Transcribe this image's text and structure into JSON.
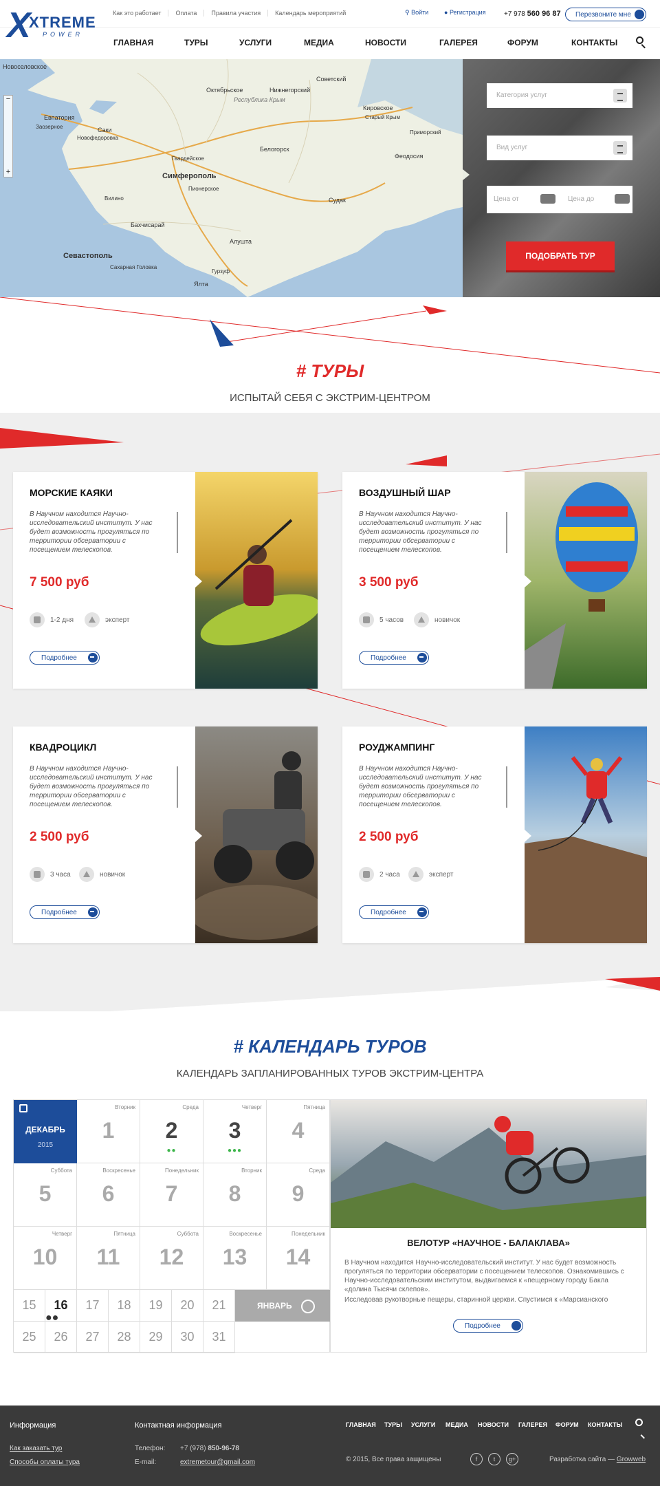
{
  "header": {
    "logo_big": "XTREME",
    "logo_small": "POWER",
    "top_links": [
      "Как это работает",
      "Оплата",
      "Правила участия",
      "Календарь мероприятий"
    ],
    "login": "Войти",
    "register": "Регистрация",
    "phone_prefix": "+7 978",
    "phone_number": "560 96 87",
    "call_button": "Перезвоните мне",
    "nav": [
      "ГЛАВНАЯ",
      "ТУРЫ",
      "УСЛУГИ",
      "МЕДИА",
      "НОВОСТИ",
      "ГАЛЕРЕЯ",
      "ФОРУМ",
      "КОНТАКТЫ"
    ]
  },
  "map": {
    "labels": {
      "novoselovskoe": "Новоселовское",
      "sovetskiy": "Советский",
      "oktyabrskoe": "Октябрьское",
      "nizhnegorskiy": "Нижнегорский",
      "respublika_krym": "Республика Крым",
      "kirovskoe": "Кировское",
      "evpatoriya": "Евпатория",
      "saki": "Саки",
      "zaozernoe": "Заозерное",
      "novofedorovka": "Новофедоровка",
      "staryy_krym": "Старый Крым",
      "primorskiy": "Приморский",
      "belogorsk": "Белогорск",
      "feodosiya": "Феодосия",
      "gvardeyskoe": "Гвардейское",
      "simferopol": "Симферополь",
      "pionerskoe": "Пионерское",
      "vilino": "Вилино",
      "bakhchisaray": "Бахчисарай",
      "sudak": "Судак",
      "sevastopol": "Севастополь",
      "alushta": "Алушта",
      "sakhar_golovka": "Сахарная Головка",
      "gurzuf": "Гурзуф",
      "yalta": "Ялта"
    }
  },
  "filter": {
    "category_placeholder": "Категория услуг",
    "type_placeholder": "Вид услуг",
    "price_from": "Цена от",
    "price_to": "Цена до",
    "submit": "ПОДОБРАТЬ ТУР"
  },
  "tours_section": {
    "title": "# ТУРЫ",
    "subtitle": "ИСПЫТАЙ СЕБЯ С ЭКСТРИМ-ЦЕНТРОМ"
  },
  "tours": [
    {
      "title": "МОРСКИЕ КАЯКИ",
      "desc": "В Научном находится Научно-исследовательский институт. У нас будет возможность прогуляться по территории обсерватории с посещением телескопов.",
      "price": "7 500 руб",
      "duration": "1-2 дня",
      "level": "эксперт",
      "more": "Подробнее"
    },
    {
      "title": "ВОЗДУШНЫЙ ШАР",
      "desc": "В Научном находится Научно-исследовательский институт. У нас будет возможность прогуляться по территории обсерватории с посещением телескопов.",
      "price": "3 500 руб",
      "duration": "5 часов",
      "level": "новичок",
      "more": "Подробнее"
    },
    {
      "title": "КВАДРОЦИКЛ",
      "desc": "В Научном находится Научно-исследовательский институт. У нас будет возможность прогуляться по территории обсерватории с посещением телескопов.",
      "price": "2 500 руб",
      "duration": "3 часа",
      "level": "новичок",
      "more": "Подробнее"
    },
    {
      "title": "РОУДЖАМПИНГ",
      "desc": "В Научном находится Научно-исследовательский институт. У нас будет возможность прогуляться по территории обсерватории с посещением телескопов.",
      "price": "2 500 руб",
      "duration": "2 часа",
      "level": "эксперт",
      "more": "Подробнее"
    }
  ],
  "calendar_section": {
    "title": "# КАЛЕНДАРЬ ТУРОВ",
    "subtitle": "КАЛЕНДАРЬ ЗАПЛАНИРОВАННЫХ ТУРОВ ЭКСТРИМ-ЦЕНТРА"
  },
  "calendar": {
    "month": "ДЕКАБРЬ",
    "year": "2015",
    "big_days": [
      {
        "day": "1",
        "dow": "Вторник",
        "dots": ""
      },
      {
        "day": "2",
        "dow": "Среда",
        "dots": "●●"
      },
      {
        "day": "3",
        "dow": "Четверг",
        "dots": "●●●"
      },
      {
        "day": "4",
        "dow": "Пятница",
        "dots": ""
      },
      {
        "day": "5",
        "dow": "Суббота",
        "dots": ""
      },
      {
        "day": "6",
        "dow": "Воскресенье",
        "dots": ""
      },
      {
        "day": "7",
        "dow": "Понедельник",
        "dots": ""
      },
      {
        "day": "8",
        "dow": "Вторник",
        "dots": ""
      },
      {
        "day": "9",
        "dow": "Среда",
        "dots": ""
      },
      {
        "day": "10",
        "dow": "Четверг",
        "dots": ""
      },
      {
        "day": "11",
        "dow": "Пятница",
        "dots": ""
      },
      {
        "day": "12",
        "dow": "Суббота",
        "dots": ""
      },
      {
        "day": "13",
        "dow": "Воскресенье",
        "dots": ""
      },
      {
        "day": "14",
        "dow": "Понедельник",
        "dots": ""
      }
    ],
    "small_days": [
      "15",
      "16",
      "17",
      "18",
      "19",
      "20",
      "21",
      "22",
      "23",
      "24",
      "25",
      "26",
      "27",
      "28",
      "29",
      "30",
      "31"
    ],
    "small_dots_16": "●●",
    "next_month": "ЯНВАРЬ"
  },
  "event": {
    "title": "ВЕЛОТУР «НАУЧНОЕ - БАЛАКЛАВА»",
    "text1": "В Научном находится Научно-исследовательский институт. У нас будет возможность прогуляться по территории обсерватории с посещением телескопов. Ознакомившись с Научно-исследовательским институтом, выдвигаемся к «пещерному городу Бакла «долина Тысячи склепов».",
    "text2": "Исследовав рукотворные пещеры, старинной церкви. Спустимся к «Марсианского",
    "more": "Подробнее"
  },
  "footer": {
    "info_title": "Информация",
    "link1": "Как заказать тур",
    "link2": "Способы оплаты тура",
    "contact_title": "Контактная информация",
    "phone_label": "Телефон:",
    "phone_prefix": "+7 (978)",
    "phone": "850-96-78",
    "email_label": "E-mail:",
    "email": "extremetour@gmail.com",
    "nav": [
      "ГЛАВНАЯ",
      "ТУРЫ",
      "УСЛУГИ",
      "МЕДИА",
      "НОВОСТИ",
      "ГАЛЕРЕЯ",
      "ФОРУМ",
      "КОНТАКТЫ"
    ],
    "copyright": "© 2015, Все права защищены",
    "dev_label": "Разработка сайта —",
    "dev": "Growweb",
    "social": [
      "f",
      "t",
      "g+"
    ]
  },
  "colors": {
    "brand": "#1d4d9a",
    "accent": "#e02a2a"
  }
}
